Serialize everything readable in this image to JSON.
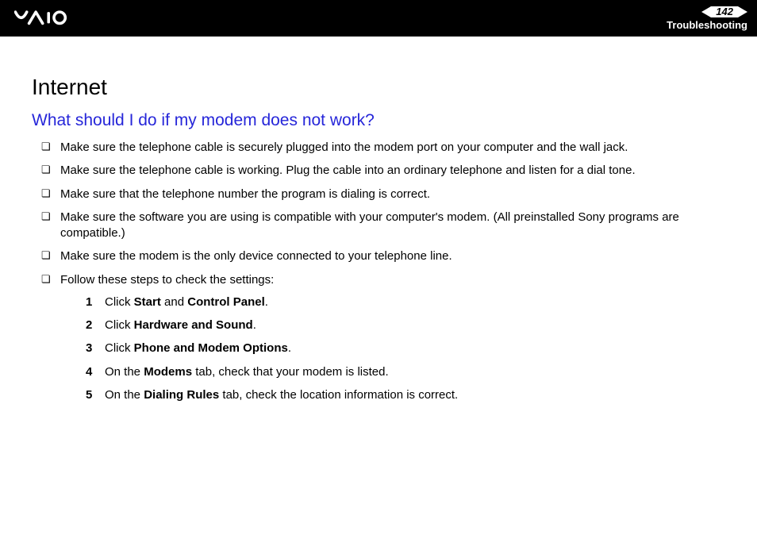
{
  "header": {
    "page_number": "142",
    "section": "Troubleshooting"
  },
  "content": {
    "title": "Internet",
    "question": "What should I do if my modem does not work?",
    "bullets": [
      "Make sure the telephone cable is securely plugged into the modem port on your computer and the wall jack.",
      "Make sure the telephone cable is working. Plug the cable into an ordinary telephone and listen for a dial tone.",
      "Make sure that the telephone number the program is dialing is correct.",
      "Make sure the software you are using is compatible with your computer's modem. (All preinstalled Sony programs are compatible.)",
      "Make sure the modem is the only device connected to your telephone line.",
      "Follow these steps to check the settings:"
    ],
    "steps": [
      {
        "n": "1",
        "pre": "Click ",
        "b1": "Start",
        "mid": " and ",
        "b2": "Control Panel",
        "post": "."
      },
      {
        "n": "2",
        "pre": "Click ",
        "b1": "Hardware and Sound",
        "mid": "",
        "b2": "",
        "post": "."
      },
      {
        "n": "3",
        "pre": "Click ",
        "b1": "Phone and Modem Options",
        "mid": "",
        "b2": "",
        "post": "."
      },
      {
        "n": "4",
        "pre": "On the ",
        "b1": "Modems",
        "mid": " tab, check that your modem is listed.",
        "b2": "",
        "post": ""
      },
      {
        "n": "5",
        "pre": "On the ",
        "b1": "Dialing Rules",
        "mid": " tab, check the location information is correct.",
        "b2": "",
        "post": ""
      }
    ]
  }
}
